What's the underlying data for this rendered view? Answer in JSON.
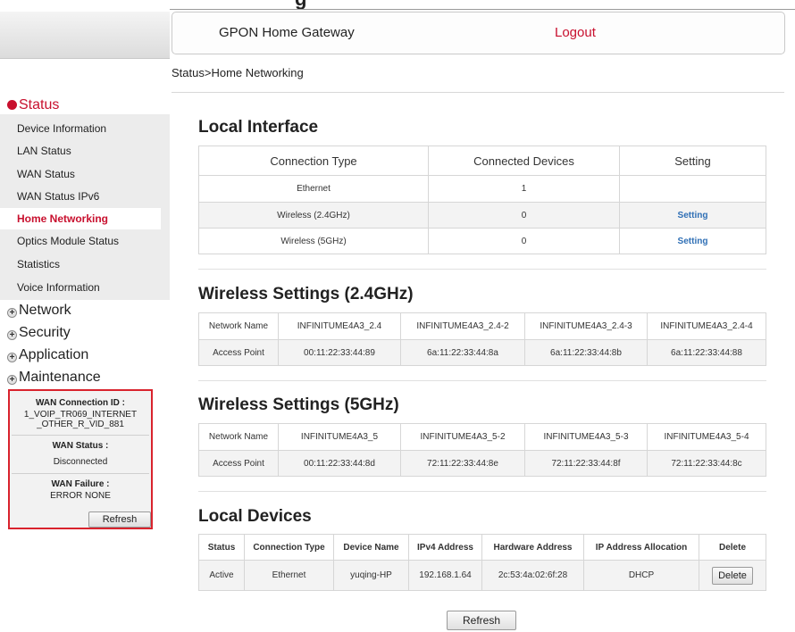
{
  "top": {
    "partial_title": "g"
  },
  "header": {
    "title": "GPON Home Gateway",
    "logout": "Logout"
  },
  "breadcrumb": "Status>Home Networking",
  "sidebar": {
    "status_label": "Status",
    "status_items": [
      "Device Information",
      "LAN Status",
      "WAN Status",
      "WAN Status IPv6",
      "Home Networking",
      "Optics Module Status",
      "Statistics",
      "Voice Information"
    ],
    "selected_item": "Home Networking",
    "sections": [
      "Network",
      "Security",
      "Application",
      "Maintenance"
    ]
  },
  "wan": {
    "connection_id_label": "WAN Connection ID :",
    "connection_id_value": "1_VOIP_TR069_INTERNET_OTHER_R_VID_881",
    "connection_id_line1": "1_VOIP_TR069_INTERNET",
    "connection_id_line2": "_OTHER_R_VID_881",
    "status_label": "WAN Status :",
    "status_value": "Disconnected",
    "failure_label": "WAN Failure :",
    "failure_value": "ERROR NONE",
    "refresh": "Refresh"
  },
  "local_interface": {
    "title": "Local Interface",
    "headers": [
      "Connection Type",
      "Connected Devices",
      "Setting"
    ],
    "rows": [
      {
        "type": "Ethernet",
        "devices": "1",
        "setting": ""
      },
      {
        "type": "Wireless (2.4GHz)",
        "devices": "0",
        "setting": "Setting"
      },
      {
        "type": "Wireless (5GHz)",
        "devices": "0",
        "setting": "Setting"
      }
    ]
  },
  "wireless_24": {
    "title": "Wireless Settings (2.4GHz)",
    "row_labels": [
      "Network Name",
      "Access Point"
    ],
    "names": [
      "INFINITUME4A3_2.4",
      "INFINITUME4A3_2.4-2",
      "INFINITUME4A3_2.4-3",
      "INFINITUME4A3_2.4-4"
    ],
    "aps": [
      "00:11:22:33:44:89",
      "6a:11:22:33:44:8a",
      "6a:11:22:33:44:8b",
      "6a:11:22:33:44:88"
    ]
  },
  "wireless_5": {
    "title": "Wireless Settings (5GHz)",
    "row_labels": [
      "Network Name",
      "Access Point"
    ],
    "names": [
      "INFINITUME4A3_5",
      "INFINITUME4A3_5-2",
      "INFINITUME4A3_5-3",
      "INFINITUME4A3_5-4"
    ],
    "aps": [
      "00:11:22:33:44:8d",
      "72:11:22:33:44:8e",
      "72:11:22:33:44:8f",
      "72:11:22:33:44:8c"
    ]
  },
  "local_devices": {
    "title": "Local Devices",
    "headers": [
      "Status",
      "Connection Type",
      "Device Name",
      "IPv4 Address",
      "Hardware Address",
      "IP Address Allocation",
      "Delete"
    ],
    "rows": [
      {
        "status": "Active",
        "type": "Ethernet",
        "name": "yuqing-HP",
        "ipv4": "192.168.1.64",
        "hw": "2c:53:4a:02:6f:28",
        "alloc": "DHCP",
        "delete": "Delete"
      }
    ]
  },
  "page_refresh": "Refresh",
  "colors": {
    "accent_red": "#c8102e",
    "link_blue": "#2f6fb5",
    "wan_box_border": "#d9232d"
  }
}
